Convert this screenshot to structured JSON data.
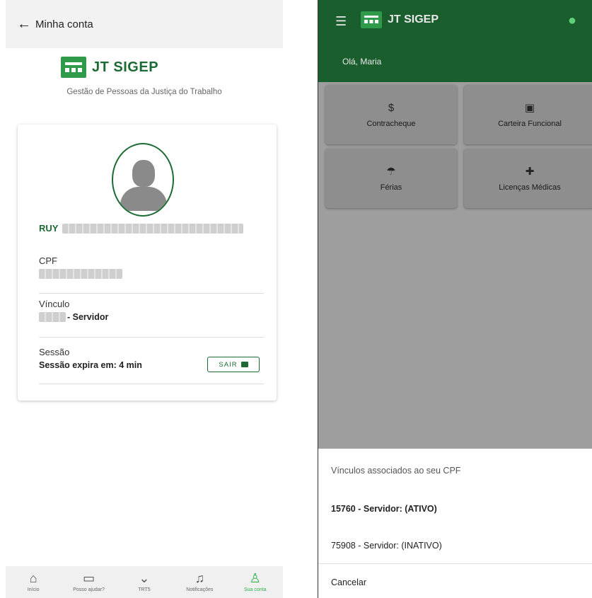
{
  "left_screen": {
    "header": {
      "title": "Minha conta"
    },
    "brand": {
      "name": "JT SIGEP",
      "subtitle": "Gestão de Pessoas da Justiça do Trabalho"
    },
    "profile": {
      "name_visible": "RUY",
      "cpf_label": "CPF",
      "vinculo_label": "Vínculo",
      "vinculo_value": "- Servidor",
      "sessao_label": "Sessão",
      "sessao_value": "Sessão expira em: 4 min",
      "sair_label": "SAIR"
    },
    "bottom_nav": [
      {
        "label": "Início",
        "icon": "home-icon"
      },
      {
        "label": "Posso ajudar?",
        "icon": "chat-icon"
      },
      {
        "label": "TRT5",
        "icon": "chevron-down-icon"
      },
      {
        "label": "Notificações",
        "icon": "bell-icon"
      },
      {
        "label": "Sua conta",
        "icon": "user-icon",
        "active": true
      }
    ]
  },
  "right_screen": {
    "appbar": {
      "brand": "JT SIGEP",
      "greeting": "Olá, Maria"
    },
    "tiles": [
      {
        "label": "Contracheque",
        "icon": "dollar-coin-icon"
      },
      {
        "label": "Carteira Funcional",
        "icon": "id-card-icon"
      },
      {
        "label": "Férias",
        "icon": "beach-umbrella-icon"
      },
      {
        "label": "Licenças Médicas",
        "icon": "medical-cross-icon"
      }
    ],
    "sheet": {
      "title": "Vínculos associados ao seu CPF",
      "options": [
        {
          "label": "15760 - Servidor: (ATIVO)"
        },
        {
          "label": "75908 - Servidor: (INATIVO)"
        }
      ],
      "cancel": "Cancelar"
    }
  },
  "colors": {
    "brand_green": "#1d6b34",
    "appbar_green": "#1b5e2d",
    "active_nav": "#2bb24c"
  }
}
